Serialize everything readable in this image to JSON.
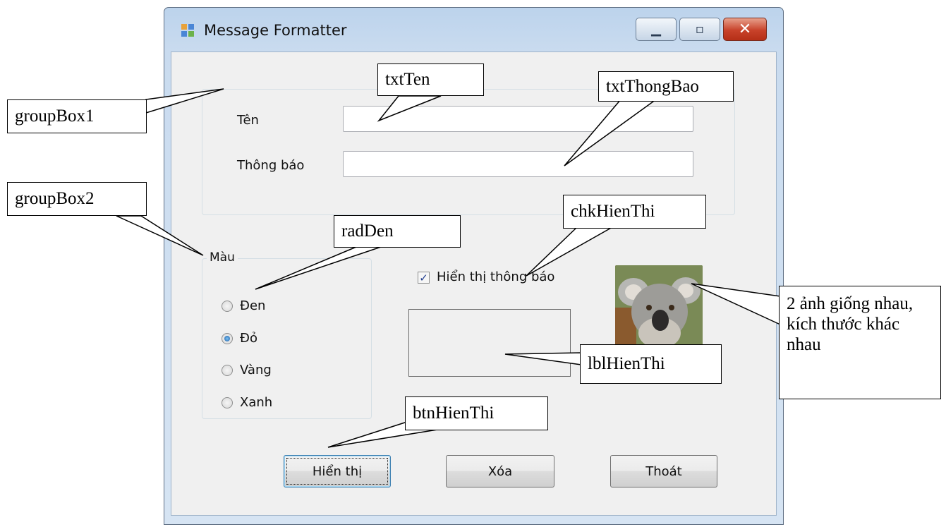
{
  "window": {
    "title": "Message Formatter",
    "controls": {
      "minimize": "minimize",
      "maximize": "maximize",
      "close": "close"
    }
  },
  "group1": {
    "ten_label": "Tên",
    "thongbao_label": "Thông báo",
    "ten_value": "",
    "thongbao_value": ""
  },
  "group2": {
    "title": "Màu",
    "options": [
      {
        "label": "Đen",
        "selected": false
      },
      {
        "label": "Đỏ",
        "selected": true
      },
      {
        "label": "Vàng",
        "selected": false
      },
      {
        "label": "Xanh",
        "selected": false
      }
    ]
  },
  "checkbox": {
    "label": "Hiển thị thông báo",
    "checked": true
  },
  "display_label": {
    "text": ""
  },
  "buttons": {
    "show": "Hiển thị",
    "clear": "Xóa",
    "exit": "Thoát"
  },
  "callouts": {
    "groupBox1": "groupBox1",
    "groupBox2": "groupBox2",
    "txtTen": "txtTen",
    "txtThongBao": "txtThongBao",
    "radDen": "radDen",
    "chkHienThi": "chkHienThi",
    "lblHienThi": "lblHienThi",
    "btnHienThi": "btnHienThi",
    "image_note": "2 ảnh giống nhau, kích thước khác nhau"
  },
  "colors": {
    "accent": "#3c7fb1",
    "close_button": "#c8422a",
    "window_frame": "#c9dbef"
  }
}
